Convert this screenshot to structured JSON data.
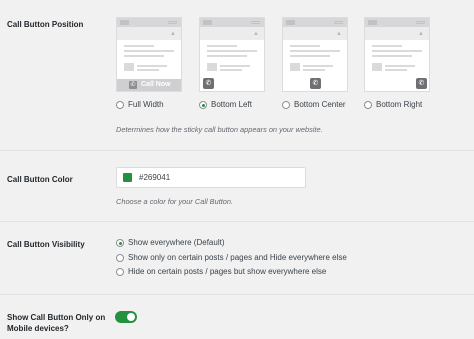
{
  "position_section": {
    "label": "Call Button Position",
    "options": [
      {
        "label": "Full Width",
        "selected": false
      },
      {
        "label": "Bottom Left",
        "selected": true
      },
      {
        "label": "Bottom Center",
        "selected": false
      },
      {
        "label": "Bottom Right",
        "selected": false
      }
    ],
    "preview_call_label": "Call Now",
    "description": "Determines how the sticky call button appears on your website."
  },
  "color_section": {
    "label": "Call Button Color",
    "value": "#269041",
    "swatch_color": "#269041",
    "description": "Choose a color for your Call Button."
  },
  "visibility_section": {
    "label": "Call Button Visibility",
    "options": [
      {
        "label": "Show everywhere (Default)",
        "selected": true
      },
      {
        "label": "Show only on certain posts / pages and Hide everywhere else",
        "selected": false
      },
      {
        "label": "Hide on certain posts / pages but show everywhere else",
        "selected": false
      }
    ]
  },
  "mobile_section": {
    "label_line1": "Show Call Button Only on",
    "label_line2": "Mobile devices?",
    "enabled": true
  },
  "icons": {
    "phone": "phone-icon",
    "mountain": "image-placeholder-icon"
  }
}
